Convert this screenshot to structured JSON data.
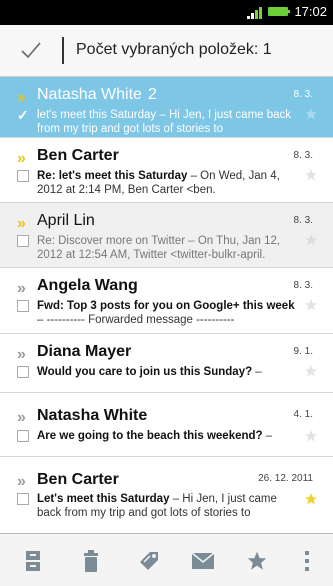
{
  "status_bar": {
    "time": "17:02",
    "signal_icon": "signal-icon",
    "battery_icon": "battery-icon"
  },
  "action_bar": {
    "done_icon": "check-icon",
    "title": "Počet vybraných položek: 1"
  },
  "emails": [
    {
      "sender": "Natasha White",
      "count": "2",
      "date": "8. 3.",
      "subject": "",
      "snippet": "let's meet this Saturday – Hi Jen, I just came back from my trip and got lots of stories to",
      "selected": true,
      "unread": false,
      "starred": false,
      "important": true
    },
    {
      "sender": "Ben Carter",
      "count": "",
      "date": "8. 3.",
      "subject": "Re: let's meet this Saturday",
      "snippet": " – On Wed, Jan 4, 2012 at 2:14 PM, Ben Carter <ben.",
      "selected": false,
      "unread": true,
      "starred": false,
      "important": true
    },
    {
      "sender": "April Lin",
      "count": "",
      "date": "8. 3.",
      "subject": "Re: Discover more on Twitter",
      "snippet": " – On Thu, Jan 12, 2012 at 12:54 AM, Twitter <twitter-bulkr-april.",
      "selected": false,
      "unread": false,
      "starred": false,
      "important": true
    },
    {
      "sender": "Angela Wang",
      "count": "",
      "date": "8. 3.",
      "subject": "Fwd: Top 3 posts for you on Google+ this week",
      "snippet": " – ---------- Forwarded message ----------",
      "selected": false,
      "unread": true,
      "starred": false,
      "important": false
    },
    {
      "sender": "Diana Mayer",
      "count": "",
      "date": "9. 1.",
      "subject": "Would you care to join us this Sunday?",
      "snippet": " –",
      "selected": false,
      "unread": true,
      "starred": false,
      "important": false
    },
    {
      "sender": "Natasha White",
      "count": "",
      "date": "4. 1.",
      "subject": "Are we going to the beach this weekend?",
      "snippet": " –",
      "selected": false,
      "unread": true,
      "starred": false,
      "important": false
    },
    {
      "sender": "Ben Carter",
      "count": "",
      "date": "26. 12. 2011",
      "subject": "Let's meet this Saturday",
      "snippet": " – Hi Jen, I just came back from my trip and got lots of stories to",
      "selected": false,
      "unread": true,
      "starred": true,
      "important": false
    }
  ],
  "toolbar": {
    "icons": [
      "archive-icon",
      "delete-icon",
      "label-icon",
      "mark-unread-icon",
      "star-icon",
      "more-icon"
    ]
  },
  "colors": {
    "selected_row": "#7ec6e6",
    "important_marker": "#e8c423",
    "star_active": "#f1d22c",
    "toolbar_icon": "#7b8c96"
  }
}
